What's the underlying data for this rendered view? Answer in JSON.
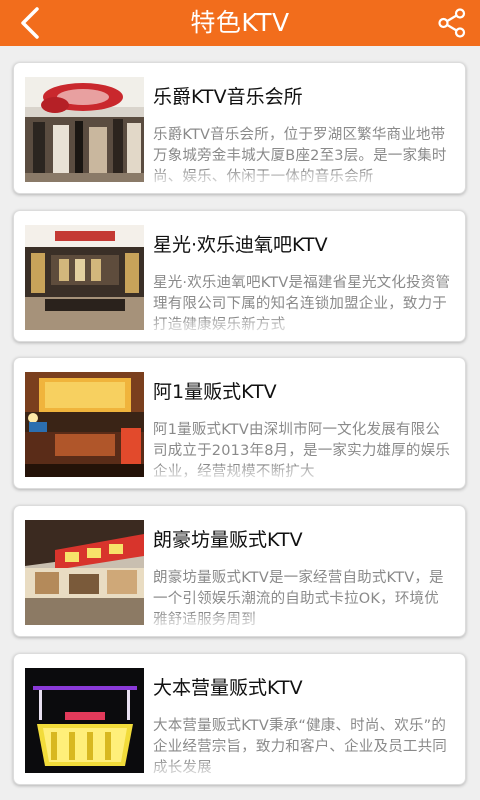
{
  "header": {
    "title": "特色KTV",
    "back_icon": "chevron-left-icon",
    "share_icon": "share-icon",
    "color": "#f26d1c"
  },
  "items": [
    {
      "title": "乐爵KTV音乐会所",
      "desc": "乐爵KTV音乐会所，位于罗湖区繁华商业地带万象城旁金丰城大厦B座2至3层。是一家集时尚、娱乐、休闲于一体的音乐会所"
    },
    {
      "title": "星光·欢乐迪氧吧KTV",
      "desc": "星光·欢乐迪氧吧KTV是福建省星光文化投资管理有限公司下属的知名连锁加盟企业，致力于打造健康娱乐新方式"
    },
    {
      "title": "阿1量贩式KTV",
      "desc": "阿1量贩式KTV由深圳市阿一文化发展有限公司成立于2013年8月，是一家实力雄厚的娱乐企业，经营规模不断扩大"
    },
    {
      "title": "朗豪坊量贩式KTV",
      "desc": "朗豪坊量贩式KTV是一家经营自助式KTV，是一个引领娱乐潮流的自助式卡拉OK，环境优雅舒适服务周到"
    },
    {
      "title": "大本营量贩式KTV",
      "desc": "大本营量贩式KTV秉承“健康、时尚、欢乐”的企业经营宗旨，致力和客户、企业及员工共同成长发展"
    }
  ]
}
